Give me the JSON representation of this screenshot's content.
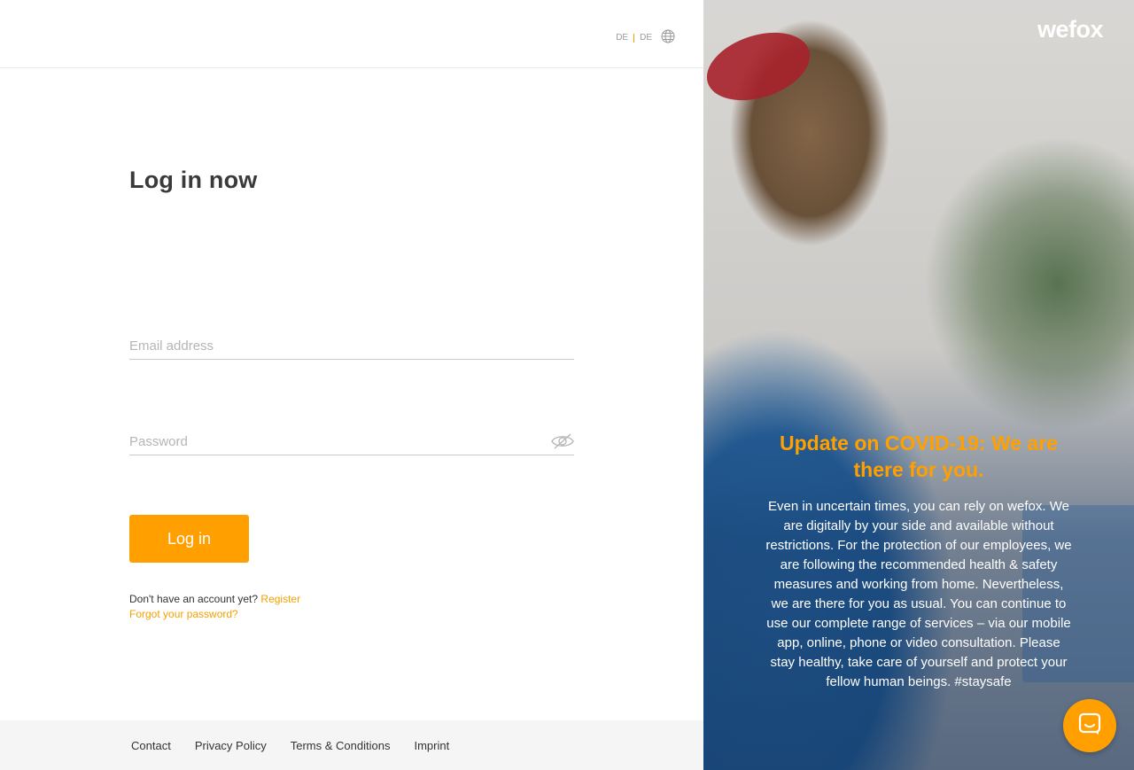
{
  "header": {
    "lang_primary": "DE",
    "lang_secondary": "DE"
  },
  "form": {
    "title": "Log in now",
    "email_placeholder": "Email address",
    "password_placeholder": "Password",
    "login_button": "Log in",
    "register_prompt": "Don't have an account yet?",
    "register_link": "Register",
    "forgot_link": "Forgot your password?"
  },
  "footer": {
    "links": [
      "Contact",
      "Privacy Policy",
      "Terms & Conditions",
      "Imprint"
    ]
  },
  "promo": {
    "brand": "wefox",
    "title": "Update on COVID-19: We are there for you.",
    "body": "Even in uncertain times, you can rely on wefox. We are digitally by your side and available without restrictions. For the protection of our employees, we are following the recommended health & safety measures and working from home. Nevertheless, we are there for you as usual. You can continue to use our complete range of services – via our mobile app, online, phone or video consultation. Please stay healthy, take care of yourself and protect your fellow human beings. #staysafe"
  },
  "colors": {
    "accent": "#ffa000",
    "footer_bg": "#f5f5f5",
    "text": "#333333"
  },
  "icons": {
    "language": "globe-icon",
    "password_toggle": "eye-slash-icon",
    "chat": "chat-bubble-icon"
  }
}
